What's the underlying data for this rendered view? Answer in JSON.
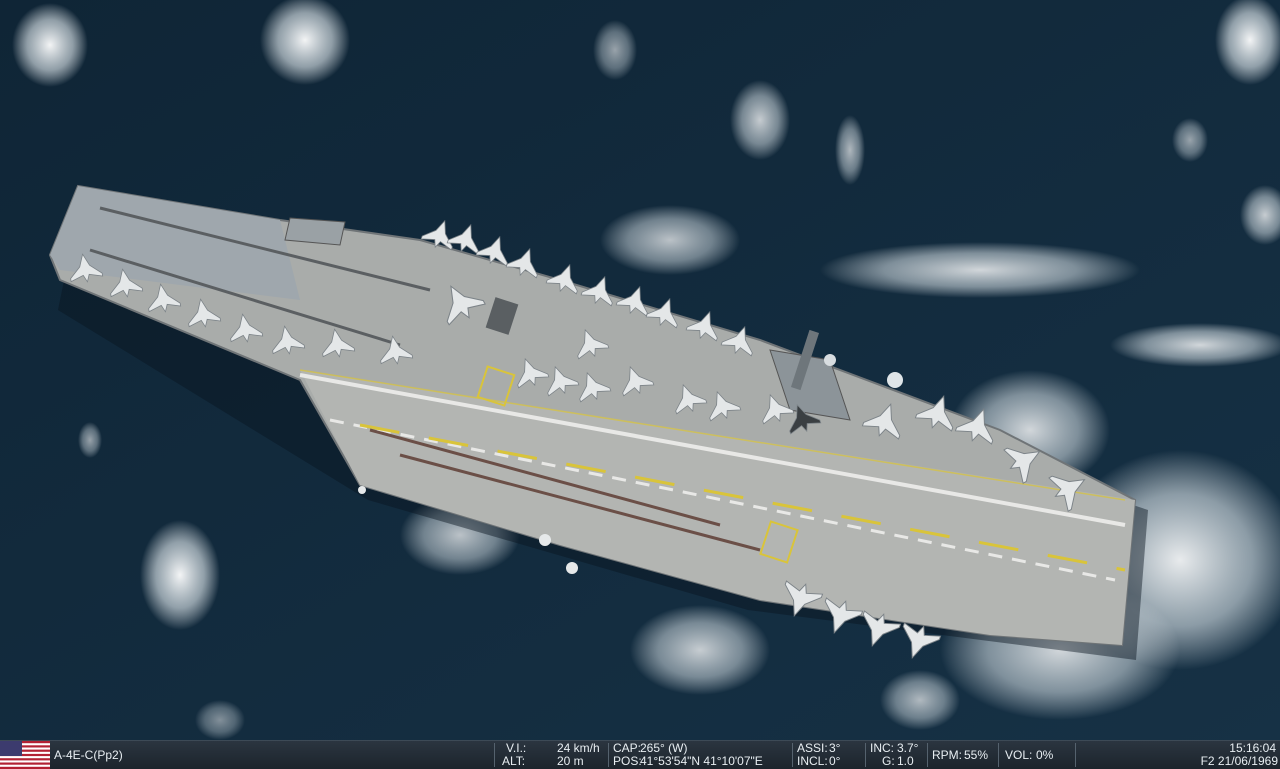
{
  "hud": {
    "aircraft": "A-4E-C(Pp2)",
    "vi_label": "V.I.:",
    "vi_value": "24 km/h",
    "alt_label": "ALT:",
    "alt_value": "20 m",
    "cap_label": "CAP:",
    "cap_value": "265° (W)",
    "pos_label": "POS:",
    "pos_value": "41°53'54\"N 41°10'07\"E",
    "assi_label": "ASSI:",
    "assi_value": "3°",
    "incl_label": "INCL:",
    "incl_value": "0°",
    "inc_label": "INC:",
    "inc_value": "3.7°",
    "g_label": "G:",
    "g_value": "1.0",
    "rpm_label": "RPM:",
    "rpm_value": "55%",
    "vol_label": "VOL:",
    "vol_value": "0%",
    "time": "15:16:04",
    "date": "F2 21/06/1969"
  },
  "colors": {
    "sea": "#12283a",
    "deck": "#a9acaa",
    "hud_bg": "#222b33",
    "stripe_yellow": "#d9c43a"
  },
  "icons": {
    "flag": "usa-flag-icon"
  }
}
